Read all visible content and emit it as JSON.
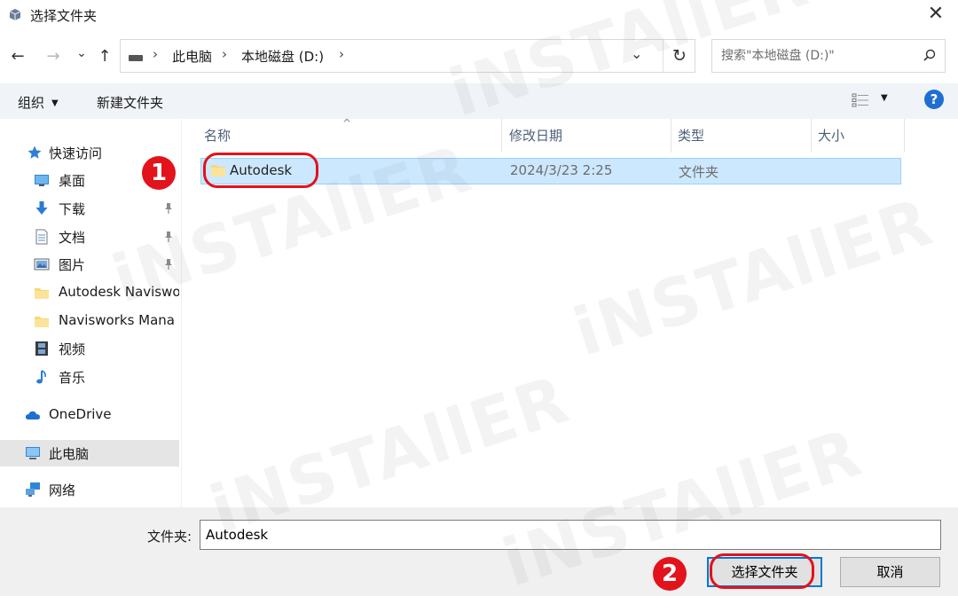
{
  "window": {
    "title": "选择文件夹",
    "close_glyph": "✕"
  },
  "nav": {
    "back_glyph": "←",
    "forward_glyph": "→",
    "recent_glyph": "⌄",
    "up_glyph": "↑",
    "breadcrumbs": [
      "此电脑",
      "本地磁盘 (D:)"
    ],
    "separator_glyph": "›",
    "dropdown_glyph": "⌄",
    "refresh_glyph": "↻"
  },
  "search": {
    "placeholder": "搜索\"本地磁盘 (D:)\""
  },
  "toolbar": {
    "organize_label": "组织",
    "new_folder_label": "新建文件夹",
    "caret_glyph": "▼",
    "help_glyph": "?"
  },
  "sidebar": {
    "items": [
      {
        "label": "快速访问",
        "icon": "star-icon"
      },
      {
        "label": "桌面",
        "icon": "desktop-icon",
        "pinned": false
      },
      {
        "label": "下载",
        "icon": "download-icon",
        "pinned": true
      },
      {
        "label": "文档",
        "icon": "document-icon",
        "pinned": true
      },
      {
        "label": "图片",
        "icon": "pictures-icon",
        "pinned": true
      },
      {
        "label": "Autodesk Naviswo",
        "icon": "folder-icon"
      },
      {
        "label": "Navisworks Mana",
        "icon": "folder-icon"
      },
      {
        "label": "视频",
        "icon": "video-icon"
      },
      {
        "label": "音乐",
        "icon": "music-icon"
      },
      {
        "label": "OneDrive",
        "icon": "cloud-icon"
      },
      {
        "label": "此电脑",
        "icon": "computer-icon",
        "selected": true
      },
      {
        "label": "网络",
        "icon": "network-icon"
      }
    ]
  },
  "list": {
    "columns": [
      "名称",
      "修改日期",
      "类型",
      "大小"
    ],
    "sort_glyph": "^",
    "rows": [
      {
        "name": "Autodesk",
        "modified": "2024/3/23 2:25",
        "type": "文件夹",
        "size": ""
      }
    ]
  },
  "bottom": {
    "folder_label": "文件夹:",
    "folder_value": "Autodesk",
    "select_button": "选择文件夹",
    "cancel_button": "取消"
  },
  "annotations": {
    "step1": "1",
    "step2": "2"
  },
  "watermark": {
    "text": "iNSTAllER"
  },
  "colors": {
    "accent": "#0078d7",
    "selection": "#cce8ff",
    "annotation": "#e2131b",
    "folder": "#f8d775"
  }
}
